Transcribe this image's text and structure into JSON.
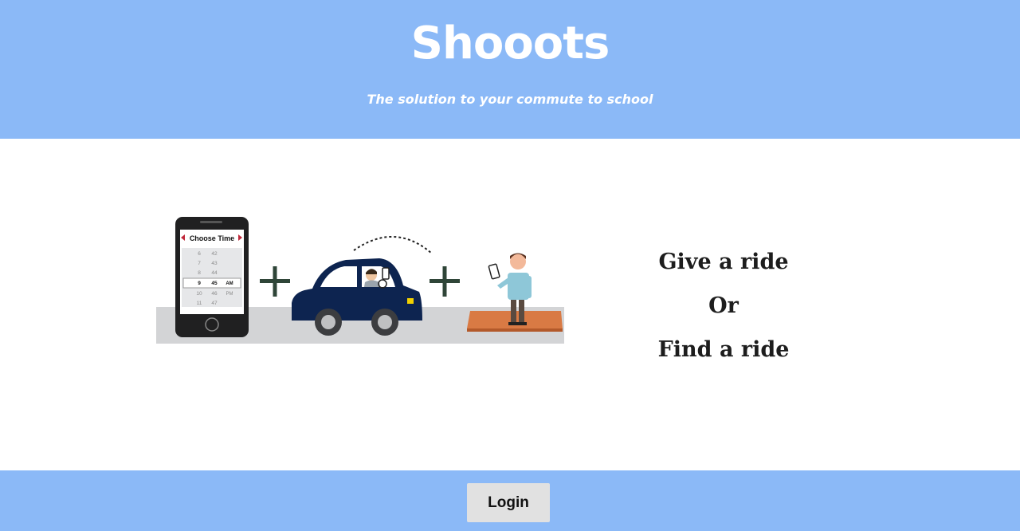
{
  "header": {
    "title": "Shooots",
    "subtitle": "The solution to your commute to school"
  },
  "illustration": {
    "phone_screen_title": "Choose Time",
    "time_rows": [
      {
        "hour": "6",
        "minute": "42",
        "period": ""
      },
      {
        "hour": "7",
        "minute": "43",
        "period": ""
      },
      {
        "hour": "8",
        "minute": "44",
        "period": ""
      },
      {
        "hour": "9",
        "minute": "45",
        "period": "AM"
      },
      {
        "hour": "10",
        "minute": "46",
        "period": "PM"
      },
      {
        "hour": "11",
        "minute": "47",
        "period": ""
      }
    ],
    "plus_sign": "+"
  },
  "main": {
    "give_label": "Give a ride",
    "or_label": "Or",
    "find_label": "Find a ride"
  },
  "footer": {
    "login_label": "Login"
  },
  "colors": {
    "header_bg": "#8bb9f7",
    "car": "#0d2450",
    "ground": "#d3d4d6",
    "platform": "#d97a44",
    "plus": "#2f4538"
  }
}
